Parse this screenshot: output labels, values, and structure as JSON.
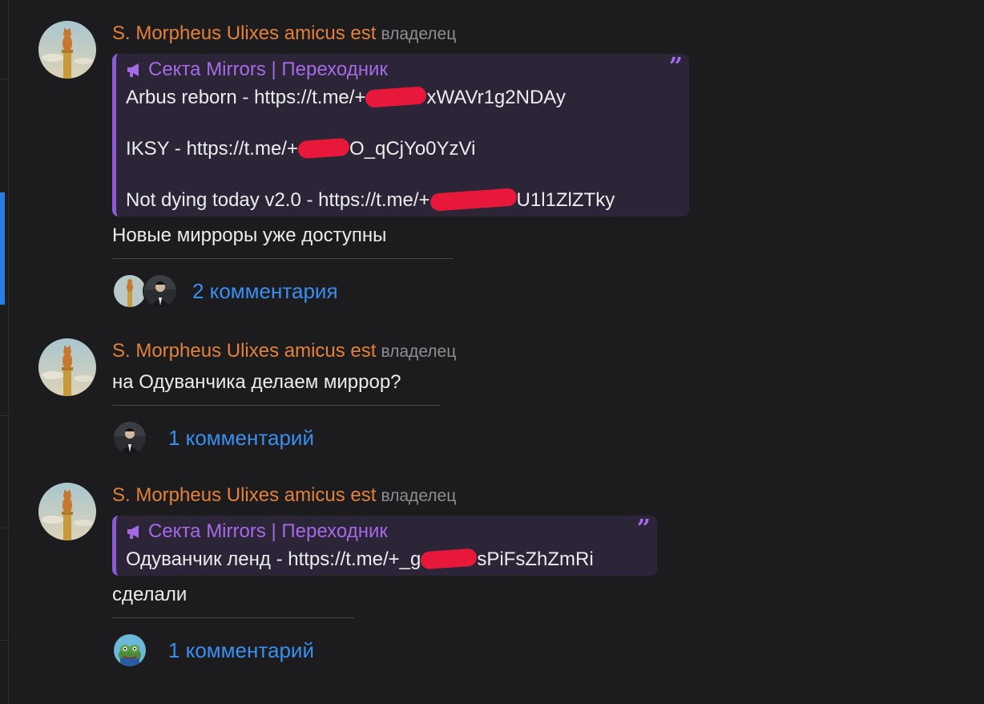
{
  "posts": [
    {
      "author": "S. Morpheus Ulixes amicus est",
      "role": "владелец",
      "quote": {
        "title": "Секта Mirrors | Переходник",
        "lines": [
          {
            "prefix": "Arbus reborn - https://t.me/+",
            "suffix": "xWAVr1g2NDAy"
          },
          {
            "prefix": "IKSY - https://t.me/+",
            "suffix": "O_qCjYo0YzVi"
          },
          {
            "prefix": "Not dying today v2.0 - https://t.me/+",
            "suffix": "U1l1ZlZTky"
          }
        ]
      },
      "text": "Новые мирроры уже доступны",
      "comments": "2 комментария"
    },
    {
      "author": "S. Morpheus Ulixes amicus est",
      "role": "владелец",
      "text": "на Одуванчика делаем миррор?",
      "comments": "1 комментарий"
    },
    {
      "author": "S. Morpheus Ulixes amicus est",
      "role": "владелец",
      "quote": {
        "title": "Секта Mirrors | Переходник",
        "lines": [
          {
            "prefix": "Одуванчик ленд - https://t.me/+_g",
            "suffix": "sPiFsZhZmRi"
          }
        ]
      },
      "text": "сделали",
      "comments": "1 комментарий"
    }
  ],
  "icons": {
    "quote_mark": "”",
    "channel": "megaphone-icon"
  },
  "colors": {
    "author": "#e3813c",
    "quote_accent": "#8d5ad6",
    "link": "#3a8ef0",
    "redaction": "#e8183b"
  }
}
